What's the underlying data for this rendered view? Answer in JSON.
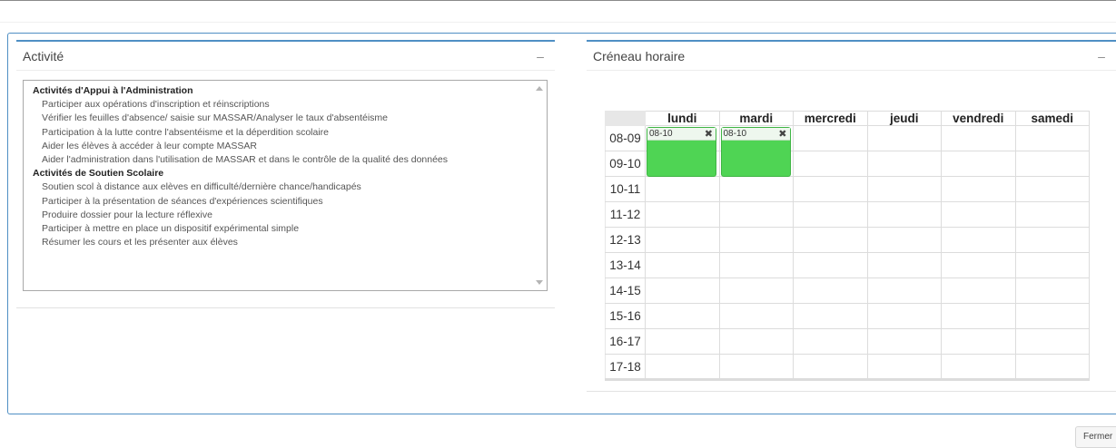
{
  "activite_panel": {
    "title": "Activité",
    "collapse_icon": "minus-icon",
    "groups": [
      {
        "label": "Activités d'Appui à l'Administration",
        "options": [
          "Participer aux opérations d'inscription et réinscriptions",
          "Vérifier les feuilles d'absence/ saisie sur MASSAR/Analyser le taux d'absentéisme",
          "Participation à la lutte contre l'absentéisme et la déperdition scolaire",
          "Aider les élèves à accéder à leur compte MASSAR",
          "Aider l'administration dans l'utilisation de MASSAR et dans le contrôle de la qualité des données"
        ]
      },
      {
        "label": "Activités de Soutien Scolaire",
        "options": [
          "Soutien scol à distance aux elèves en difficulté/dernière chance/handicapés",
          "Participer à la présentation de séances d'expériences scientifiques",
          "Produire dossier pour la lecture réflexive",
          "Participer à mettre en place un dispositif expérimental simple",
          "Résumer les cours et les présenter aux élèves"
        ]
      }
    ]
  },
  "creneau_panel": {
    "title": "Créneau horaire",
    "collapse_icon": "minus-icon",
    "days": [
      "lundi",
      "mardi",
      "mercredi",
      "jeudi",
      "vendredi",
      "samedi"
    ],
    "hours": [
      "08-09",
      "09-10",
      "10-11",
      "11-12",
      "12-13",
      "13-14",
      "14-15",
      "15-16",
      "16-17",
      "17-18"
    ],
    "events": [
      {
        "day": "lundi",
        "start_hour": "08-09",
        "span": 2,
        "label": "08-10",
        "color": "#4fd454",
        "remove_icon": "close-x-icon"
      },
      {
        "day": "mardi",
        "start_hour": "08-09",
        "span": 2,
        "label": "08-10",
        "color": "#4fd454",
        "remove_icon": "close-x-icon"
      }
    ]
  },
  "footer": {
    "close_label": "Fermer"
  },
  "colors": {
    "accent_border": "#4f8fc4",
    "event_green": "#4fd454"
  }
}
